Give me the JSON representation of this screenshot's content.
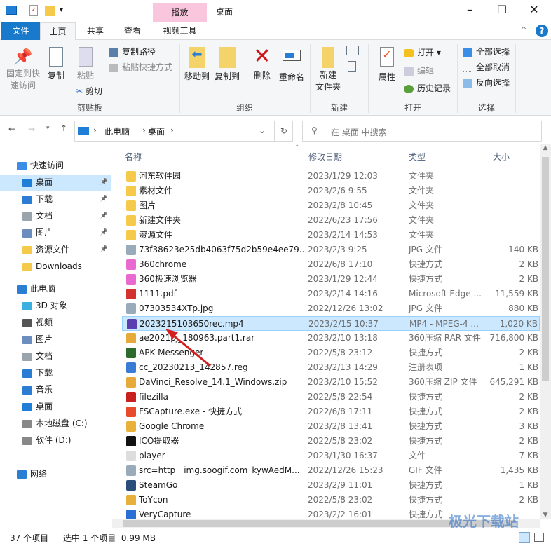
{
  "window": {
    "title": "桌面",
    "context_tab": "播放",
    "minimize": "–",
    "maximize": "☐",
    "close": "✕"
  },
  "tabs": [
    "文件",
    "主页",
    "共享",
    "查看",
    "视频工具"
  ],
  "ribbon": {
    "clipboard": {
      "pin": "固定到快\n速访问",
      "copy": "复制",
      "paste": "粘贴",
      "copy_path": "复制路径",
      "paste_shortcut": "粘贴快捷方式",
      "cut": "剪切",
      "group": "剪贴板"
    },
    "organize": {
      "move_to": "移动到",
      "copy_to": "复制到",
      "delete": "删除",
      "rename": "重命名",
      "group": "组织"
    },
    "new": {
      "new_folder": "新建\n文件夹",
      "group": "新建"
    },
    "open": {
      "properties": "属性",
      "open": "打开",
      "edit": "编辑",
      "history": "历史记录",
      "group": "打开"
    },
    "select": {
      "select_all": "全部选择",
      "select_none": "全部取消",
      "invert": "反向选择",
      "group": "选择"
    }
  },
  "address": {
    "path": [
      "此电脑",
      "桌面"
    ],
    "search_placeholder": "在 桌面 中搜索"
  },
  "sidebar": [
    {
      "label": "快速访问",
      "icon": "star-icon",
      "color": "#3a8ee6",
      "indent": 0
    },
    {
      "label": "桌面",
      "icon": "desktop-icon",
      "color": "#1f7fd6",
      "indent": 1,
      "selected": true,
      "pinned": true
    },
    {
      "label": "下载",
      "icon": "download-icon",
      "color": "#2b7cd3",
      "indent": 1,
      "pinned": true
    },
    {
      "label": "文档",
      "icon": "document-icon",
      "color": "#9aa4ad",
      "indent": 1,
      "pinned": true
    },
    {
      "label": "图片",
      "icon": "pictures-icon",
      "color": "#6c8ebf",
      "indent": 1,
      "pinned": true
    },
    {
      "label": "资源文件",
      "icon": "folder-icon",
      "color": "#f5c94a",
      "indent": 1,
      "pinned": true
    },
    {
      "label": "Downloads",
      "icon": "folder-icon",
      "color": "#f5c94a",
      "indent": 1
    },
    {
      "label": "此电脑",
      "icon": "computer-icon",
      "color": "#2a7fd4",
      "indent": 0
    },
    {
      "label": "3D 对象",
      "icon": "3d-objects-icon",
      "color": "#3ab0e0",
      "indent": 1
    },
    {
      "label": "视频",
      "icon": "video-icon",
      "color": "#555",
      "indent": 1
    },
    {
      "label": "图片",
      "icon": "pictures-icon",
      "color": "#6c8ebf",
      "indent": 1
    },
    {
      "label": "文档",
      "icon": "document-icon",
      "color": "#9aa4ad",
      "indent": 1
    },
    {
      "label": "下载",
      "icon": "download-icon",
      "color": "#2b7cd3",
      "indent": 1
    },
    {
      "label": "音乐",
      "icon": "music-icon",
      "color": "#2b7cd3",
      "indent": 1
    },
    {
      "label": "桌面",
      "icon": "desktop-icon",
      "color": "#1f7fd6",
      "indent": 1
    },
    {
      "label": "本地磁盘 (C:)",
      "icon": "drive-icon",
      "color": "#888",
      "indent": 1
    },
    {
      "label": "软件 (D:)",
      "icon": "drive-icon",
      "color": "#888",
      "indent": 1
    },
    {
      "label": "网络",
      "icon": "network-icon",
      "color": "#2a7fd4",
      "indent": 0
    }
  ],
  "columns": {
    "name": "名称",
    "date": "修改日期",
    "type": "类型",
    "size": "大小"
  },
  "files": [
    {
      "name": "河东软件园",
      "date": "2023/1/29 12:03",
      "type": "文件夹",
      "size": "",
      "icon": "folder-icon",
      "color": "#f5c94a"
    },
    {
      "name": "素材文件",
      "date": "2023/2/6 9:55",
      "type": "文件夹",
      "size": "",
      "icon": "folder-icon",
      "color": "#f5c94a"
    },
    {
      "name": "图片",
      "date": "2023/2/8 10:45",
      "type": "文件夹",
      "size": "",
      "icon": "folder-icon",
      "color": "#f5c94a"
    },
    {
      "name": "新建文件夹",
      "date": "2022/6/23 17:56",
      "type": "文件夹",
      "size": "",
      "icon": "folder-icon",
      "color": "#f5c94a"
    },
    {
      "name": "资源文件",
      "date": "2023/2/14 14:53",
      "type": "文件夹",
      "size": "",
      "icon": "folder-icon",
      "color": "#f5c94a"
    },
    {
      "name": "73f38623e25db4063f75d2b59e4ee79...",
      "date": "2023/2/3 9:25",
      "type": "JPG 文件",
      "size": "140 KB",
      "icon": "image-file-icon",
      "color": "#9ab"
    },
    {
      "name": "360chrome",
      "date": "2022/6/8 17:10",
      "type": "快捷方式",
      "size": "2 KB",
      "icon": "360chrome-icon",
      "color": "#e86ad0"
    },
    {
      "name": "360极速浏览器",
      "date": "2023/1/29 12:44",
      "type": "快捷方式",
      "size": "2 KB",
      "icon": "360-browser-icon",
      "color": "#e86ad0"
    },
    {
      "name": "1111.pdf",
      "date": "2023/2/14 14:16",
      "type": "Microsoft Edge ...",
      "size": "11,559 KB",
      "icon": "pdf-icon",
      "color": "#d3302f"
    },
    {
      "name": "07303534XTp.jpg",
      "date": "2022/12/26 13:02",
      "type": "JPG 文件",
      "size": "880 KB",
      "icon": "image-file-icon",
      "color": "#9ab"
    },
    {
      "name": "2023215103650rec.mp4",
      "date": "2023/2/15 10:37",
      "type": "MP4 - MPEG-4 ...",
      "size": "1,020 KB",
      "icon": "mp4-icon",
      "color": "#5b3fb0",
      "selected": true
    },
    {
      "name": "ae2021pj_180963.part1.rar",
      "date": "2023/2/10 13:18",
      "type": "360压缩 RAR 文件",
      "size": "716,800 KB",
      "icon": "archive-icon",
      "color": "#e6a93a"
    },
    {
      "name": "APK Messenger",
      "date": "2022/5/8 23:12",
      "type": "快捷方式",
      "size": "2 KB",
      "icon": "apk-icon",
      "color": "#2c6b2c"
    },
    {
      "name": "cc_20230213_142857.reg",
      "date": "2023/2/13 14:29",
      "type": "注册表项",
      "size": "1 KB",
      "icon": "registry-icon",
      "color": "#3a7bd5"
    },
    {
      "name": "DaVinci_Resolve_14.1_Windows.zip",
      "date": "2023/2/10 15:52",
      "type": "360压缩 ZIP 文件",
      "size": "645,291 KB",
      "icon": "archive-icon",
      "color": "#e6a93a"
    },
    {
      "name": "filezilla",
      "date": "2022/5/8 22:54",
      "type": "快捷方式",
      "size": "2 KB",
      "icon": "filezilla-icon",
      "color": "#c8201e"
    },
    {
      "name": "FSCapture.exe - 快捷方式",
      "date": "2022/6/8 17:11",
      "type": "快捷方式",
      "size": "2 KB",
      "icon": "fscapture-icon",
      "color": "#e84b2b"
    },
    {
      "name": "Google Chrome",
      "date": "2023/2/8 13:41",
      "type": "快捷方式",
      "size": "3 KB",
      "icon": "chrome-icon",
      "color": "#e9b13a"
    },
    {
      "name": "ICO提取器",
      "date": "2022/5/8 23:02",
      "type": "快捷方式",
      "size": "2 KB",
      "icon": "ico-extractor-icon",
      "color": "#111"
    },
    {
      "name": "player",
      "date": "2023/1/30 16:37",
      "type": "文件",
      "size": "7 KB",
      "icon": "file-icon",
      "color": "#ddd"
    },
    {
      "name": "src=http__img.soogif.com_kywAedM...",
      "date": "2022/12/26 15:23",
      "type": "GIF 文件",
      "size": "1,435 KB",
      "icon": "image-file-icon",
      "color": "#9ab"
    },
    {
      "name": "SteamGo",
      "date": "2023/2/9 11:01",
      "type": "快捷方式",
      "size": "1 KB",
      "icon": "steamgo-icon",
      "color": "#2a4d7a"
    },
    {
      "name": "ToYcon",
      "date": "2022/5/8 23:02",
      "type": "快捷方式",
      "size": "2 KB",
      "icon": "toycon-icon",
      "color": "#e6b03a"
    },
    {
      "name": "VeryCapture",
      "date": "2023/2/2 16:01",
      "type": "快捷方式",
      "size": "",
      "icon": "verycapture-icon",
      "color": "#2a6fd4"
    }
  ],
  "status": {
    "count": "37 个项目",
    "selected": "选中 1 个项目  0.99 MB"
  },
  "watermark": "极光下载站 www.xz7.com",
  "colors": {
    "accent": "#1979ca",
    "selection": "#cce8ff",
    "context_tab": "#f9c6dd"
  }
}
